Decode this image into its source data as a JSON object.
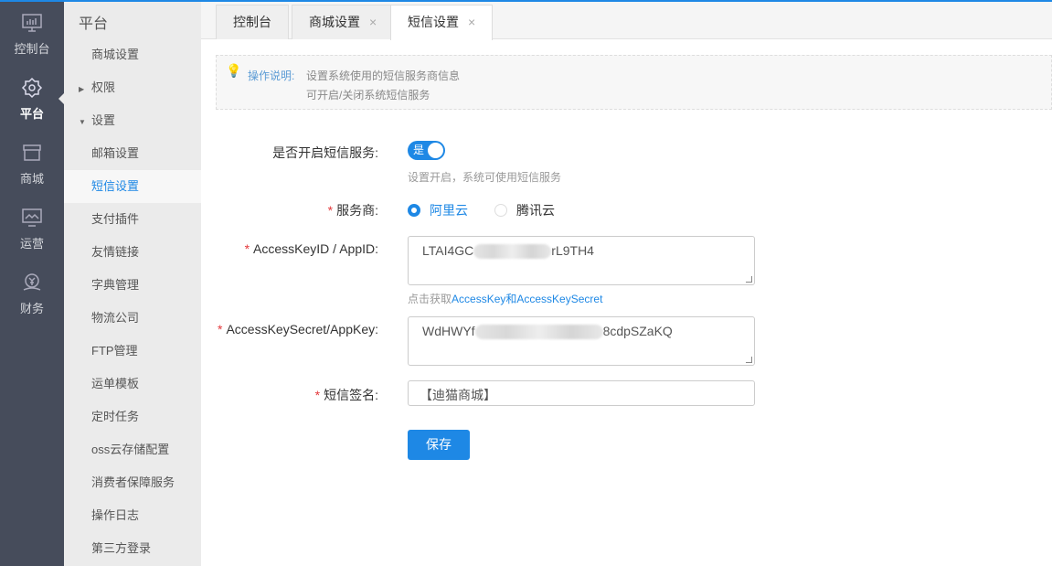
{
  "nav_primary": [
    {
      "label": "控制台",
      "icon": "monitor-chart-icon"
    },
    {
      "label": "平台",
      "icon": "gear-icon",
      "active": true
    },
    {
      "label": "商城",
      "icon": "store-icon"
    },
    {
      "label": "运营",
      "icon": "trend-monitor-icon"
    },
    {
      "label": "财务",
      "icon": "yuan-hand-icon"
    }
  ],
  "nav_secondary": {
    "title": "平台",
    "items": [
      {
        "label": "商城设置"
      },
      {
        "label": "权限",
        "group": "collapsed"
      },
      {
        "label": "设置",
        "group": "expanded"
      },
      {
        "label": "邮箱设置"
      },
      {
        "label": "短信设置",
        "active": true
      },
      {
        "label": "支付插件"
      },
      {
        "label": "友情链接"
      },
      {
        "label": "字典管理"
      },
      {
        "label": "物流公司"
      },
      {
        "label": "FTP管理"
      },
      {
        "label": "运单模板"
      },
      {
        "label": "定时任务"
      },
      {
        "label": "oss云存储配置"
      },
      {
        "label": "消费者保障服务"
      },
      {
        "label": "操作日志"
      },
      {
        "label": "第三方登录"
      }
    ]
  },
  "tabs": [
    {
      "label": "控制台"
    },
    {
      "label": "商城设置",
      "close": "×"
    },
    {
      "label": "短信设置",
      "close": "×",
      "active": true
    }
  ],
  "tip": {
    "label": "操作说明:",
    "lines": [
      "设置系统使用的短信服务商信息",
      "可开启/关闭系统短信服务"
    ]
  },
  "form": {
    "enable": {
      "label": "是否开启短信服务:",
      "value": "是",
      "on": true,
      "hint": "设置开启，系统可使用短信服务"
    },
    "provider": {
      "label": "服务商:",
      "options": [
        "阿里云",
        "腾讯云"
      ],
      "selected": "阿里云"
    },
    "access_key_id": {
      "label": "AccessKeyID / AppID:",
      "value_start": "LTAI4GC",
      "value_end": "rL9TH4",
      "hint_prefix": "点击获取",
      "hint_link": "AccessKey和AccessKeySecret"
    },
    "access_key_secret": {
      "label": "AccessKeySecret/AppKey:",
      "value_start": "WdHWYf",
      "value_end": "8cdpSZaKQ"
    },
    "signature": {
      "label": "短信签名:",
      "value": "【迪猫商城】"
    },
    "required_mark": "*",
    "save_label": "保存"
  }
}
